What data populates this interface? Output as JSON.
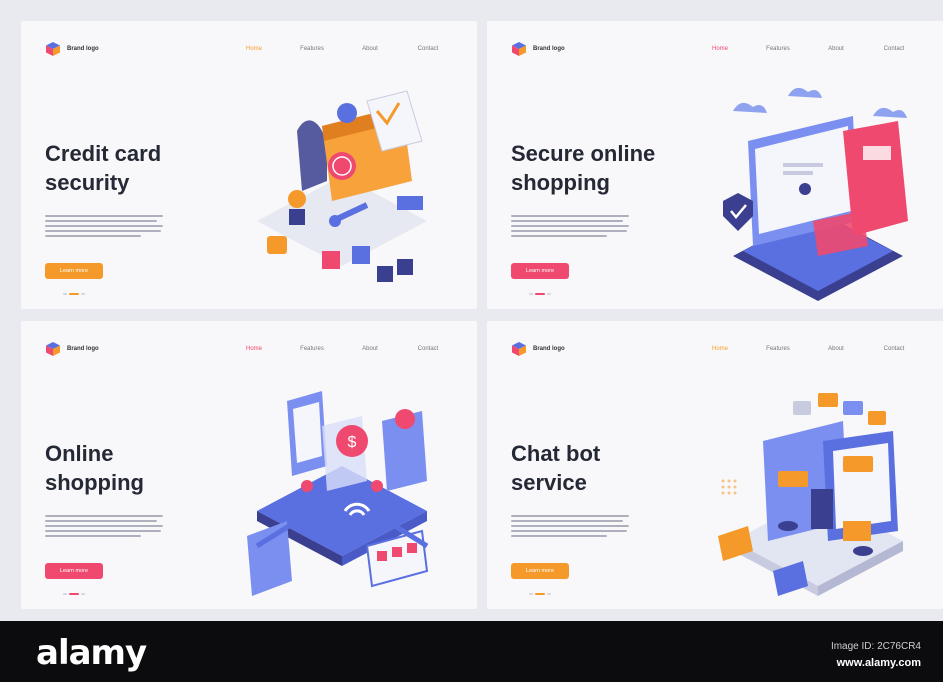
{
  "cards": [
    {
      "brand": "Brand logo",
      "nav": [
        "Home",
        "Features",
        "About",
        "Contact"
      ],
      "active_nav": 0,
      "headline": [
        "Credit card",
        "security"
      ],
      "button": "Learn more",
      "button_color": "#f59a2a"
    },
    {
      "brand": "Brand logo",
      "nav": [
        "Home",
        "Features",
        "About",
        "Contact"
      ],
      "active_nav": 0,
      "headline": [
        "Secure online",
        "shopping"
      ],
      "button": "Learn more",
      "button_color": "#f0496f"
    },
    {
      "brand": "Brand logo",
      "nav": [
        "Home",
        "Features",
        "About",
        "Contact"
      ],
      "active_nav": 0,
      "headline": [
        "Online",
        "shopping"
      ],
      "button": "Learn more",
      "button_color": "#f0496f"
    },
    {
      "brand": "Brand logo",
      "nav": [
        "Home",
        "Features",
        "About",
        "Contact"
      ],
      "active_nav": 0,
      "headline": [
        "Chat bot",
        "service"
      ],
      "button": "Learn more",
      "button_color": "#f59a2a"
    }
  ],
  "footer": {
    "logo": "alamy",
    "image_id": "Image ID: 2C76CR4",
    "url": "www.alamy.com"
  },
  "colors": {
    "accent_orange": "#f59a2a",
    "accent_pink": "#f0496f",
    "navy": "#252835",
    "blue": "#5a6fe0"
  }
}
